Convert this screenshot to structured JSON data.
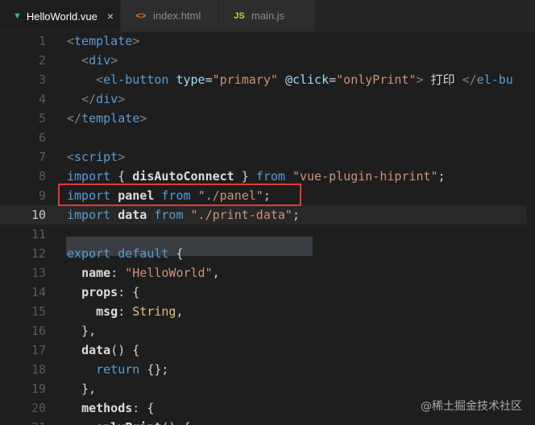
{
  "tabs": [
    {
      "label": "HelloWorld.vue",
      "icon": "vue-icon",
      "icon_glyph": "▼",
      "icon_color": "#41b883",
      "active": true,
      "close": "×"
    },
    {
      "label": "index.html",
      "icon": "html-icon",
      "icon_glyph": "<>",
      "icon_color": "#e37933",
      "active": false
    },
    {
      "label": "main.js",
      "icon": "js-icon",
      "icon_glyph": "JS",
      "icon_color": "#cbcb41",
      "active": false
    }
  ],
  "lines": [
    {
      "n": "1",
      "tokens": [
        [
          "t-br",
          "<"
        ],
        [
          "t-tag",
          "template"
        ],
        [
          "t-br",
          ">"
        ]
      ]
    },
    {
      "n": "2",
      "tokens": [
        [
          "t-plain",
          "  "
        ],
        [
          "t-br",
          "<"
        ],
        [
          "t-tag",
          "div"
        ],
        [
          "t-br",
          ">"
        ]
      ]
    },
    {
      "n": "3",
      "tokens": [
        [
          "t-plain",
          "    "
        ],
        [
          "t-br",
          "<"
        ],
        [
          "t-tag",
          "el-button"
        ],
        [
          "t-plain",
          " "
        ],
        [
          "t-attr",
          "type"
        ],
        [
          "t-plain",
          "="
        ],
        [
          "t-str",
          "\"primary\""
        ],
        [
          "t-plain",
          " "
        ],
        [
          "t-attr",
          "@click"
        ],
        [
          "t-plain",
          "="
        ],
        [
          "t-str",
          "\"onlyPrint\""
        ],
        [
          "t-br",
          ">"
        ],
        [
          "t-plain",
          " 打印 "
        ],
        [
          "t-br",
          "</"
        ],
        [
          "t-tag",
          "el-bu"
        ]
      ]
    },
    {
      "n": "4",
      "tokens": [
        [
          "t-plain",
          "  "
        ],
        [
          "t-br",
          "</"
        ],
        [
          "t-tag",
          "div"
        ],
        [
          "t-br",
          ">"
        ]
      ]
    },
    {
      "n": "5",
      "tokens": [
        [
          "t-br",
          "</"
        ],
        [
          "t-tag",
          "template"
        ],
        [
          "t-br",
          ">"
        ]
      ]
    },
    {
      "n": "6",
      "tokens": []
    },
    {
      "n": "7",
      "tokens": [
        [
          "t-br",
          "<"
        ],
        [
          "t-tag",
          "script"
        ],
        [
          "t-br",
          ">"
        ]
      ]
    },
    {
      "n": "8",
      "tokens": [
        [
          "t-kw",
          "import"
        ],
        [
          "t-plain",
          " { "
        ],
        [
          "t-id",
          "disAutoConnect"
        ],
        [
          "t-plain",
          " } "
        ],
        [
          "t-kw",
          "from"
        ],
        [
          "t-plain",
          " "
        ],
        [
          "t-str",
          "\"vue-plugin-hiprint\""
        ],
        [
          "t-plain",
          ";"
        ]
      ]
    },
    {
      "n": "9",
      "tokens": [
        [
          "t-kw",
          "import"
        ],
        [
          "t-plain",
          " "
        ],
        [
          "t-id",
          "panel"
        ],
        [
          "t-plain",
          " "
        ],
        [
          "t-kw",
          "from"
        ],
        [
          "t-plain",
          " "
        ],
        [
          "t-str",
          "\"./panel\""
        ],
        [
          "t-plain",
          ";"
        ]
      ]
    },
    {
      "n": "10",
      "tokens": [
        [
          "t-kw",
          "import"
        ],
        [
          "t-plain",
          " "
        ],
        [
          "t-id",
          "data"
        ],
        [
          "t-plain",
          " "
        ],
        [
          "t-kw",
          "from"
        ],
        [
          "t-plain",
          " "
        ],
        [
          "t-str",
          "\"./print-data\""
        ],
        [
          "t-plain",
          ";"
        ]
      ],
      "current": true
    },
    {
      "n": "11",
      "tokens": []
    },
    {
      "n": "12",
      "tokens": [
        [
          "t-kw",
          "export"
        ],
        [
          "t-plain",
          " "
        ],
        [
          "t-kw",
          "default"
        ],
        [
          "t-plain",
          " {"
        ]
      ]
    },
    {
      "n": "13",
      "tokens": [
        [
          "t-plain",
          "  "
        ],
        [
          "t-id",
          "name"
        ],
        [
          "t-plain",
          ": "
        ],
        [
          "t-str",
          "\"HelloWorld\""
        ],
        [
          "t-plain",
          ","
        ]
      ]
    },
    {
      "n": "14",
      "tokens": [
        [
          "t-plain",
          "  "
        ],
        [
          "t-id",
          "props"
        ],
        [
          "t-plain",
          ": {"
        ]
      ]
    },
    {
      "n": "15",
      "tokens": [
        [
          "t-plain",
          "    "
        ],
        [
          "t-id",
          "msg"
        ],
        [
          "t-plain",
          ": "
        ],
        [
          "t-type",
          "String"
        ],
        [
          "t-plain",
          ","
        ]
      ]
    },
    {
      "n": "16",
      "tokens": [
        [
          "t-plain",
          "  },"
        ]
      ]
    },
    {
      "n": "17",
      "tokens": [
        [
          "t-plain",
          "  "
        ],
        [
          "t-id",
          "data"
        ],
        [
          "t-plain",
          "() {"
        ]
      ]
    },
    {
      "n": "18",
      "tokens": [
        [
          "t-plain",
          "    "
        ],
        [
          "t-kw",
          "return"
        ],
        [
          "t-plain",
          " {};"
        ]
      ]
    },
    {
      "n": "19",
      "tokens": [
        [
          "t-plain",
          "  },"
        ]
      ]
    },
    {
      "n": "20",
      "tokens": [
        [
          "t-plain",
          "  "
        ],
        [
          "t-id",
          "methods"
        ],
        [
          "t-plain",
          ": {"
        ]
      ]
    },
    {
      "n": "21",
      "tokens": [
        [
          "t-plain",
          "    "
        ],
        [
          "t-id",
          "onlyPrint"
        ],
        [
          "t-plain",
          "() {"
        ]
      ]
    }
  ],
  "watermark": "@稀土掘金技术社区"
}
